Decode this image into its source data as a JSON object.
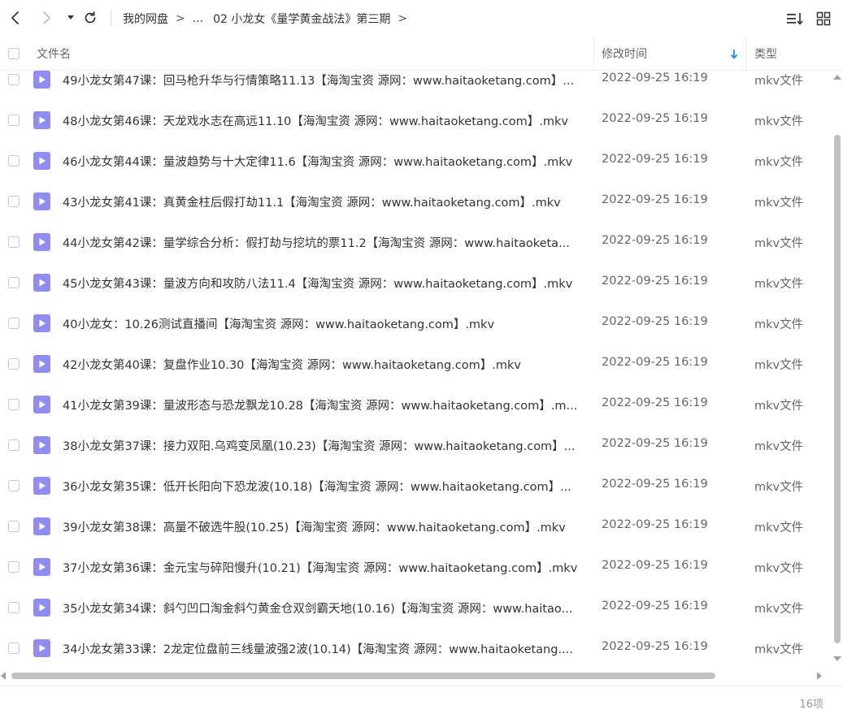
{
  "toolbar": {
    "breadcrumb": [
      "我的网盘",
      "...",
      "02 小龙女《量学黄金战法》第三期"
    ],
    "separator": ">"
  },
  "header": {
    "name": "文件名",
    "modified": "修改时间",
    "type": "类型"
  },
  "files": [
    {
      "name": "49小龙女第47课：回马枪升华与行情策略11.13【海淘宝资 源网：www.haitaoketang.com】...",
      "modified": "2022-09-25 16:19",
      "type": "mkv文件"
    },
    {
      "name": "48小龙女第46课：天龙戏水志在高远11.10【海淘宝资 源网：www.haitaoketang.com】.mkv",
      "modified": "2022-09-25 16:19",
      "type": "mkv文件"
    },
    {
      "name": "46小龙女第44课：量波趋势与十大定律11.6【海淘宝资 源网：www.haitaoketang.com】.mkv",
      "modified": "2022-09-25 16:19",
      "type": "mkv文件"
    },
    {
      "name": "43小龙女第41课：真黄金柱后假打劫11.1【海淘宝资 源网：www.haitaoketang.com】.mkv",
      "modified": "2022-09-25 16:19",
      "type": "mkv文件"
    },
    {
      "name": "44小龙女第42课：量学综合分析：假打劫与挖坑的票11.2【海淘宝资 源网：www.haitaoketa...",
      "modified": "2022-09-25 16:19",
      "type": "mkv文件"
    },
    {
      "name": "45小龙女第43课：量波方向和攻防八法11.4【海淘宝资 源网：www.haitaoketang.com】.mkv",
      "modified": "2022-09-25 16:19",
      "type": "mkv文件"
    },
    {
      "name": "40小龙女：10.26测试直播间【海淘宝资 源网：www.haitaoketang.com】.mkv",
      "modified": "2022-09-25 16:19",
      "type": "mkv文件"
    },
    {
      "name": "42小龙女第40课：复盘作业10.30【海淘宝资 源网：www.haitaoketang.com】.mkv",
      "modified": "2022-09-25 16:19",
      "type": "mkv文件"
    },
    {
      "name": "41小龙女第39课：量波形态与恐龙飘龙10.28【海淘宝资 源网：www.haitaoketang.com】.m...",
      "modified": "2022-09-25 16:19",
      "type": "mkv文件"
    },
    {
      "name": "38小龙女第37课：接力双阳.乌鸡变凤凰(10.23)【海淘宝资 源网：www.haitaoketang.com】...",
      "modified": "2022-09-25 16:19",
      "type": "mkv文件"
    },
    {
      "name": "36小龙女第35课：低开长阳向下恐龙波(10.18)【海淘宝资 源网：www.haitaoketang.com】...",
      "modified": "2022-09-25 16:19",
      "type": "mkv文件"
    },
    {
      "name": "39小龙女第38课：高量不破选牛股(10.25)【海淘宝资 源网：www.haitaoketang.com】.mkv",
      "modified": "2022-09-25 16:19",
      "type": "mkv文件"
    },
    {
      "name": "37小龙女第36课：金元宝与碎阳慢升(10.21)【海淘宝资 源网：www.haitaoketang.com】.mkv",
      "modified": "2022-09-25 16:19",
      "type": "mkv文件"
    },
    {
      "name": "35小龙女第34课：斜勺凹口淘金斜勺黄金仓双剑霸天地(10.16)【海淘宝资 源网：www.haitao...",
      "modified": "2022-09-25 16:19",
      "type": "mkv文件"
    },
    {
      "name": "34小龙女第33课：2龙定位盘前三线量波强2波(10.14)【海淘宝资 源网：www.haitaoketang....",
      "modified": "2022-09-25 16:19",
      "type": "mkv文件"
    }
  ],
  "footer": {
    "count": "16项"
  },
  "colors": {
    "file_icon": "#8f8cf2",
    "sort_arrow": "#1a8cff",
    "scroll_thumb": "#c1c1c1"
  }
}
